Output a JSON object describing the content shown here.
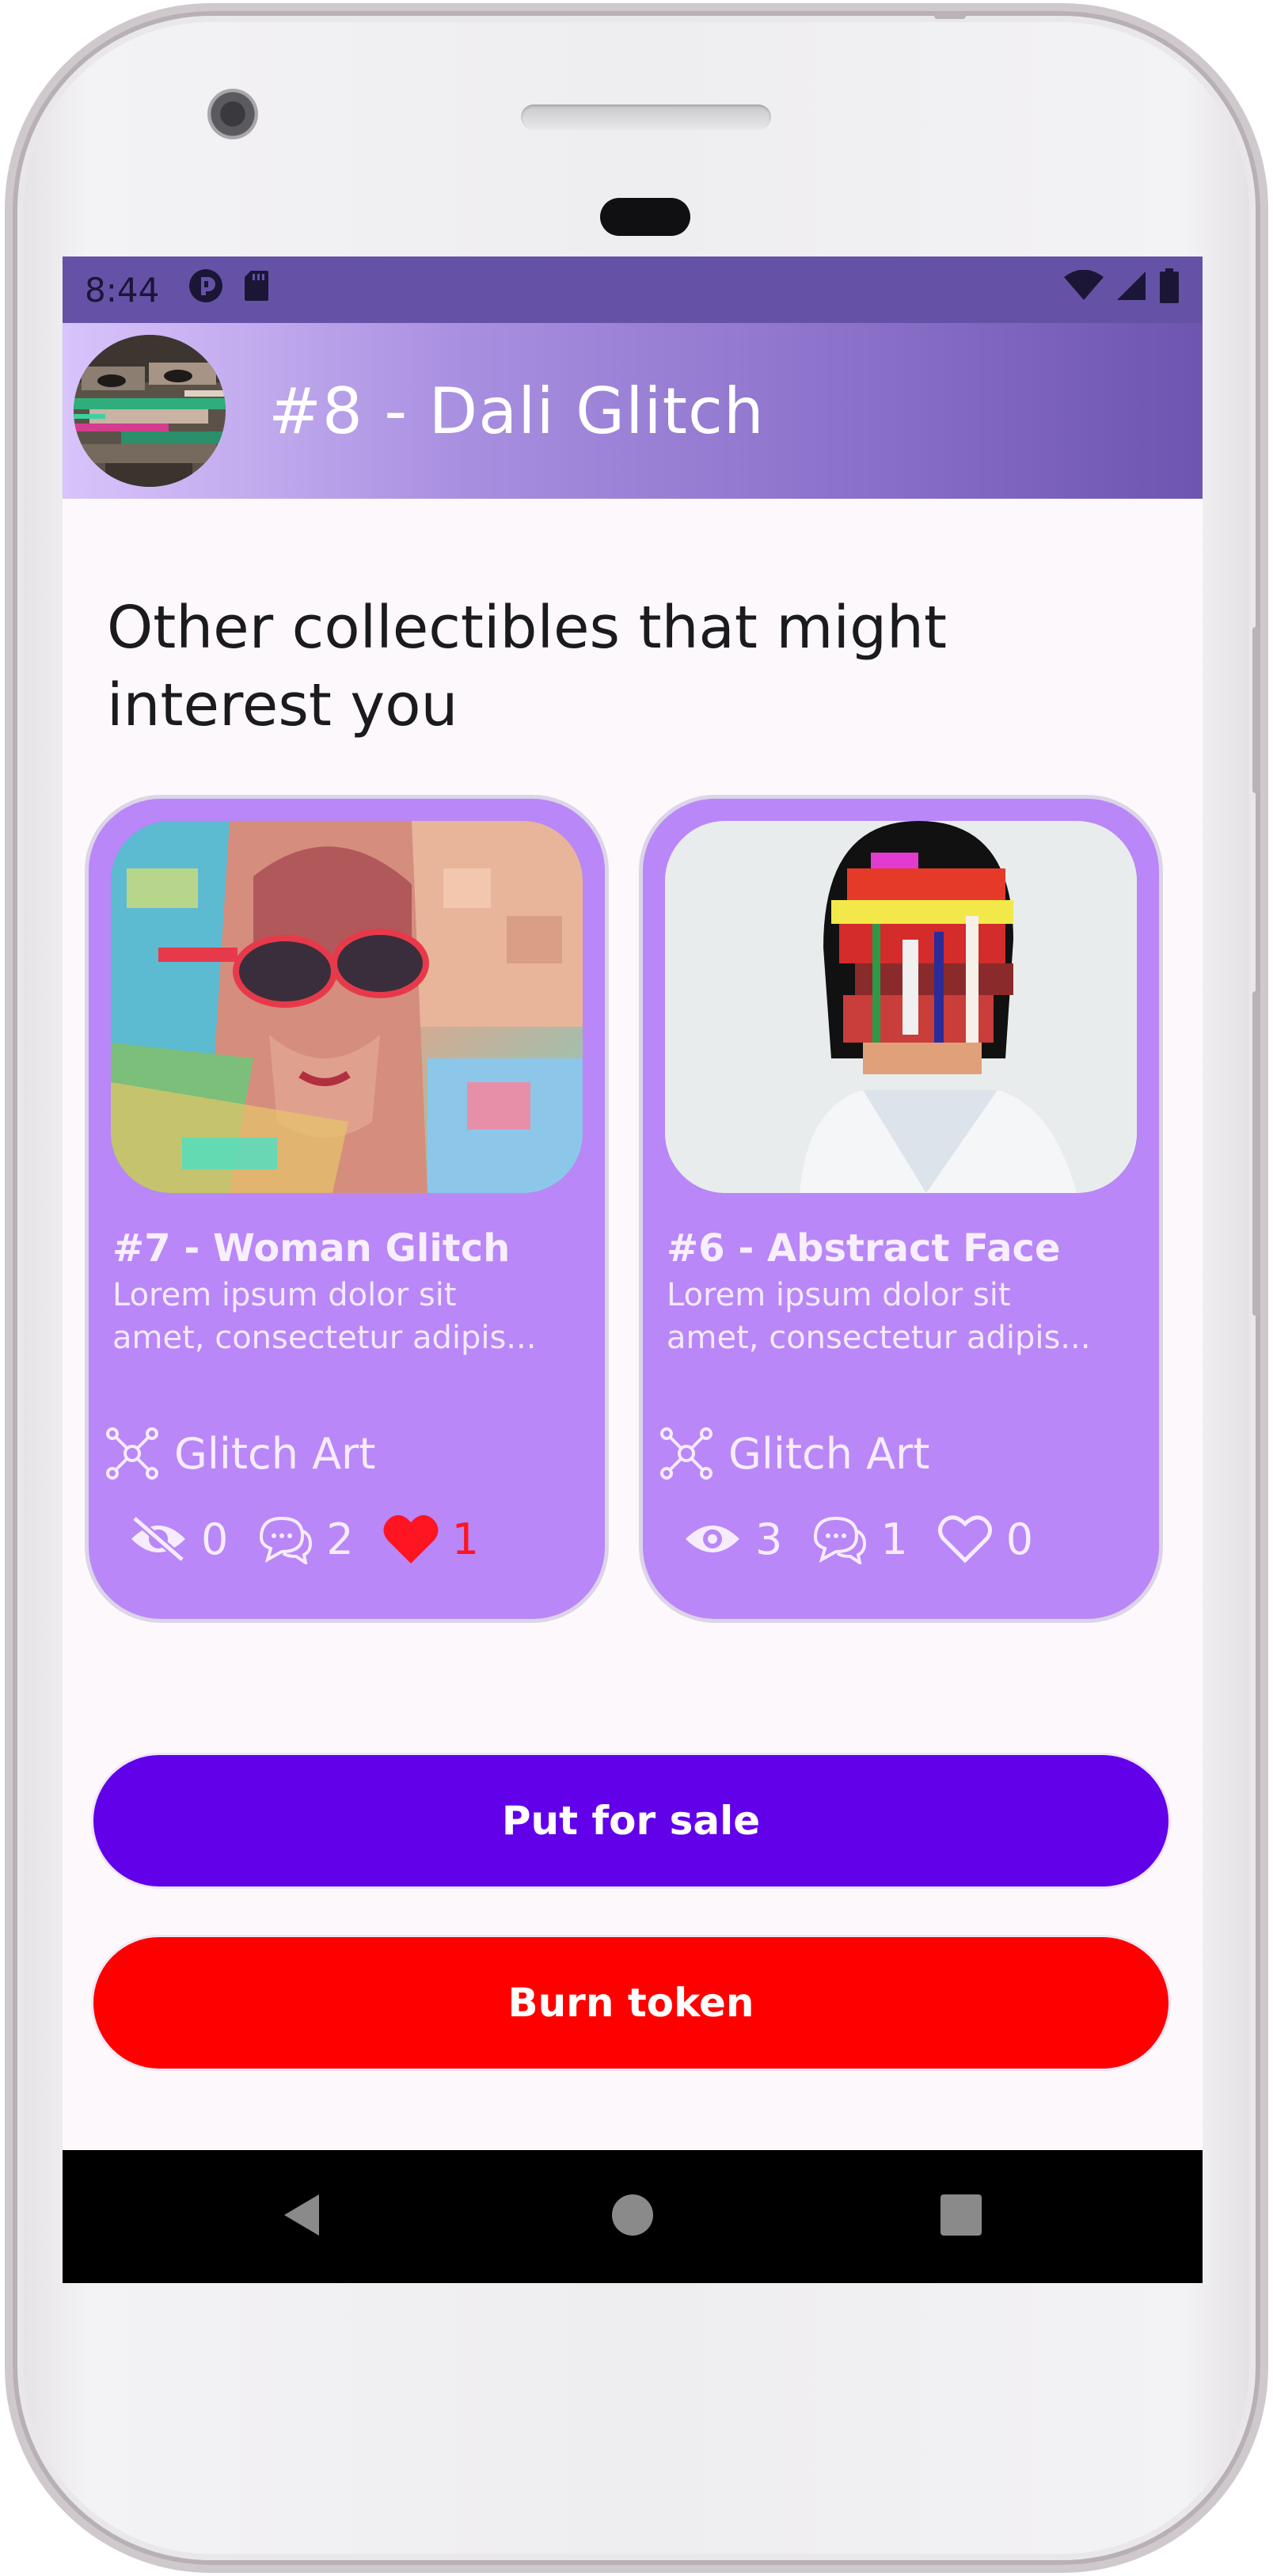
{
  "status_bar": {
    "time": "8:44",
    "icons_left": [
      "app-notification-icon",
      "sd-card-icon"
    ],
    "icons_right": [
      "wifi-icon",
      "cell-signal-icon",
      "battery-icon"
    ],
    "color": "#6552a6"
  },
  "app_bar": {
    "title": "#8 - Dali Glitch",
    "avatar_icon": "dali-glitch-avatar",
    "gradient": [
      "#d8c4fb",
      "#6d55b0"
    ]
  },
  "section": {
    "heading": "Other collectibles that might interest you"
  },
  "cards": [
    {
      "title": "#7 - Woman Glitch",
      "desc_line1": "Lorem ipsum dolor sit",
      "desc_line2": "amet, consectetur adipis...",
      "category": "Glitch Art",
      "views": "0",
      "views_icon": "eye-off-icon",
      "comments": "2",
      "likes": "1",
      "liked": true,
      "image": "woman-glitch-image"
    },
    {
      "title": "#6 - Abstract Face",
      "desc_line1": "Lorem ipsum dolor sit",
      "desc_line2": "amet, consectetur adipis...",
      "category": "Glitch Art",
      "views": "3",
      "views_icon": "eye-icon",
      "comments": "1",
      "likes": "0",
      "liked": false,
      "image": "abstract-face-image"
    }
  ],
  "buttons": {
    "sale_label": "Put for sale",
    "burn_label": "Burn token",
    "sale_color": "#6200ea",
    "burn_color": "#ff0000"
  },
  "card_color": "#b987f7",
  "nav": {
    "icons": [
      "back-icon",
      "home-icon",
      "recents-icon"
    ]
  }
}
